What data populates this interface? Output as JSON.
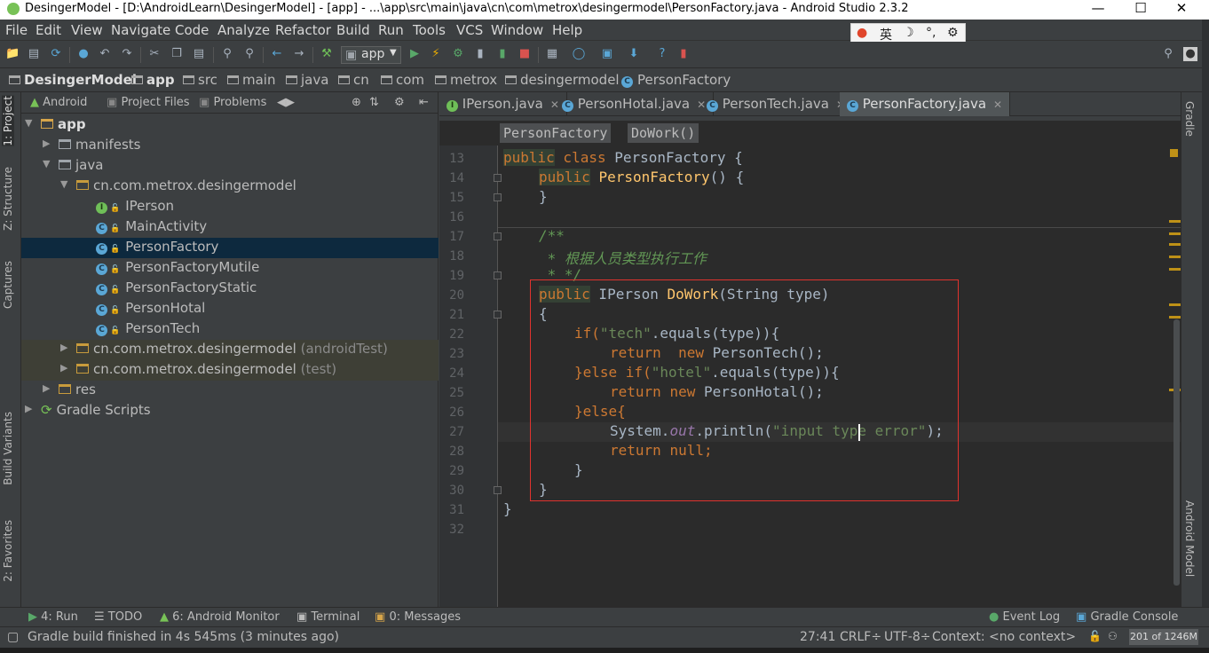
{
  "window": {
    "title": "DesingerModel - [D:\\AndroidLearn\\DesingerModel] - [app] - ...\\app\\src\\main\\java\\cn\\com\\metrox\\desingermodel\\PersonFactory.java - Android Studio 2.3.2",
    "minimize": "—",
    "maximize": "☐",
    "close": "✕"
  },
  "menu": [
    "File",
    "Edit",
    "View",
    "Navigate",
    "Code",
    "Analyze",
    "Refactor",
    "Build",
    "Run",
    "Tools",
    "VCS",
    "Window",
    "Help"
  ],
  "ime": {
    "lang": "英",
    "moon": "☽",
    "punct": "°,",
    "gear": "⚙"
  },
  "toolbar": {
    "run_config": "app"
  },
  "breadcrumbs": [
    "DesingerModel",
    "app",
    "src",
    "main",
    "java",
    "cn",
    "com",
    "metrox",
    "desingermodel",
    "PersonFactory"
  ],
  "left_strip": [
    "1: Project",
    "Z: Structure",
    "Captures",
    "Build Variants",
    "2: Favorites"
  ],
  "project_tabs": [
    "Android",
    "Project Files",
    "Problems"
  ],
  "tree": [
    {
      "label": "app",
      "suffix": ""
    },
    {
      "label": "manifests",
      "suffix": ""
    },
    {
      "label": "java",
      "suffix": ""
    },
    {
      "label": "cn.com.metrox.desingermodel",
      "suffix": ""
    },
    {
      "label": "IPerson",
      "suffix": ""
    },
    {
      "label": "MainActivity",
      "suffix": ""
    },
    {
      "label": "PersonFactory",
      "suffix": ""
    },
    {
      "label": "PersonFactoryMutile",
      "suffix": ""
    },
    {
      "label": "PersonFactoryStatic",
      "suffix": ""
    },
    {
      "label": "PersonHotal",
      "suffix": ""
    },
    {
      "label": "PersonTech",
      "suffix": ""
    },
    {
      "label": "cn.com.metrox.desingermodel",
      "suffix": " (androidTest)"
    },
    {
      "label": "cn.com.metrox.desingermodel",
      "suffix": " (test)"
    },
    {
      "label": "res",
      "suffix": ""
    },
    {
      "label": "Gradle Scripts",
      "suffix": ""
    }
  ],
  "editor_tabs": [
    "IPerson.java",
    "PersonHotal.java",
    "PersonTech.java",
    "PersonFactory.java"
  ],
  "code_breadcrumb": [
    "PersonFactory",
    "DoWork()"
  ],
  "line_numbers": [
    "13",
    "14",
    "15",
    "16",
    "17",
    "18",
    "19",
    "20",
    "21",
    "22",
    "23",
    "24",
    "25",
    "26",
    "27",
    "28",
    "29",
    "30",
    "31",
    "32"
  ],
  "code": {
    "l13": [
      "public",
      " class ",
      "PersonFactory",
      " {"
    ],
    "l14": [
      "public",
      " ",
      "PersonFactory",
      "() {"
    ],
    "l15": "}",
    "l17": "/**",
    "l18": " * 根据人员类型执行工作",
    "l19": " * */",
    "l20": [
      "public",
      " IPerson ",
      "DoWork",
      "(String type)"
    ],
    "l21": "{",
    "l22": [
      "if(",
      "\"tech\"",
      ".equals(type)){"
    ],
    "l23": [
      "return",
      "  ",
      "new",
      " PersonTech();"
    ],
    "l24": [
      "}else if(",
      "\"hotel\"",
      ".equals(type)){"
    ],
    "l25": [
      "return",
      " ",
      "new",
      " PersonHotal();"
    ],
    "l26": "}else{",
    "l27": [
      "System.",
      "out",
      ".println(",
      "\"input type error\"",
      ");"
    ],
    "l28": [
      "return",
      " ",
      "null",
      ";"
    ],
    "l29": "}",
    "l30": "}",
    "l31": "}"
  },
  "right_strip": [
    "Gradle",
    "Android Model"
  ],
  "bottom_tabs": [
    "4: Run",
    "TODO",
    "6: Android Monitor",
    "Terminal",
    "0: Messages",
    "Event Log",
    "Gradle Console"
  ],
  "status": {
    "message": "Gradle build finished in 4s 545ms (3 minutes ago)",
    "position": "27:41",
    "line_sep": "CRLF÷",
    "encoding": "UTF-8÷",
    "context": "Context: <no context>",
    "memory": "201 of 1246M"
  },
  "colors": {
    "accent_red_box": "#e0332e",
    "keyword": "#cc7832",
    "string": "#6a8759",
    "method": "#ffc66d",
    "comment": "#629755"
  }
}
